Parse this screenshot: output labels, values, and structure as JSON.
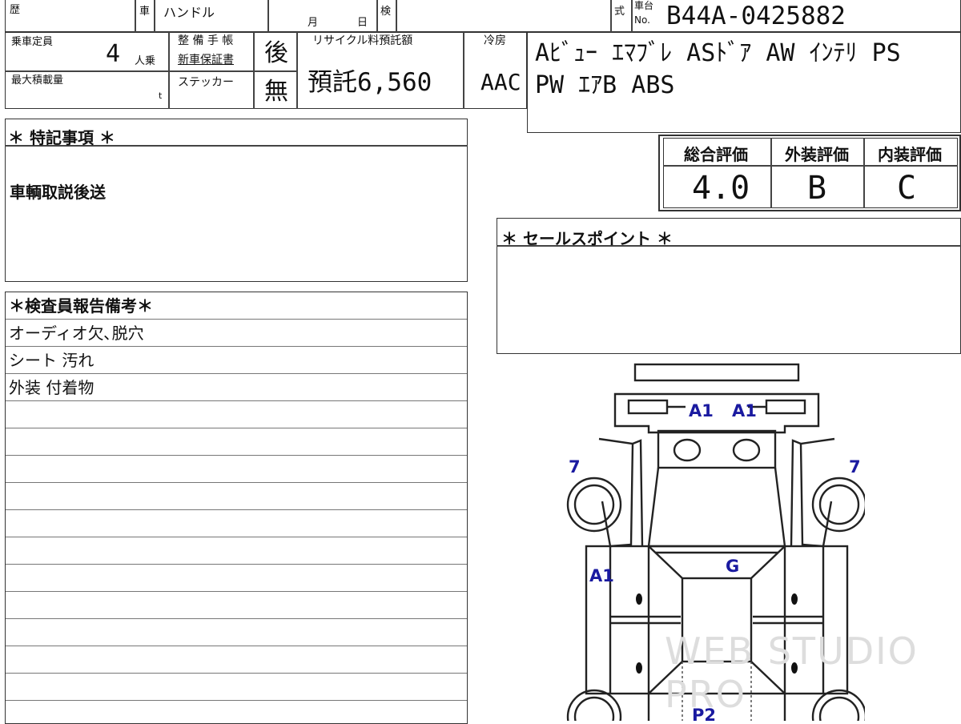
{
  "header": {
    "history_label": "歴",
    "car_label": "車",
    "handle_label": "ハンドル",
    "month_label": "月",
    "day_label": "日",
    "inspection_label": "検",
    "model_label": "式",
    "chassis_label_top": "車台",
    "chassis_label_bottom": "No.",
    "chassis_number": "B44A-0425882"
  },
  "specs": {
    "capacity_label": "乗車定員",
    "capacity_value": "4",
    "capacity_unit": "人乗",
    "max_load_label": "最大積載量",
    "max_load_unit": "t",
    "maintenance_label": "整 備 手 帳",
    "warranty_label": "新車保証書",
    "maintenance_value": "後",
    "sticker_label": "ステッカー",
    "sticker_value": "無",
    "recycle_label": "リサイクル料預託額",
    "recycle_value": "預託6,560",
    "ac_label": "冷房",
    "ac_value": "AAC"
  },
  "equipment": {
    "line1": "Aﾋﾞｭｰ ｴﾏﾌﾞﾚ ASﾄﾞｱ AW ｲﾝﾃﾘ PS",
    "line2": "PW ｴｱB ABS"
  },
  "grades": {
    "overall_label": "総合評価",
    "overall_value": "4.0",
    "exterior_label": "外装評価",
    "exterior_value": "B",
    "interior_label": "内装評価",
    "interior_value": "C"
  },
  "special_notes": {
    "title": "＊ 特記事項 ＊",
    "text": "車輌取説後送"
  },
  "sales_points": {
    "title": "＊ セールスポイント ＊"
  },
  "inspector_report": {
    "title": "＊検査員報告備考＊",
    "rows": [
      "オーディオ欠､脱穴",
      "シート 汚れ",
      "外装 付着物",
      "",
      "",
      "",
      "",
      "",
      "",
      "",
      "",
      "",
      ""
    ]
  },
  "damage_map": {
    "marks": [
      "A1",
      "A1",
      "7",
      "7",
      "A1",
      "G",
      "P2"
    ],
    "mark_color": "#1a1aa0"
  },
  "watermark": "WEB STUDIO PRO"
}
